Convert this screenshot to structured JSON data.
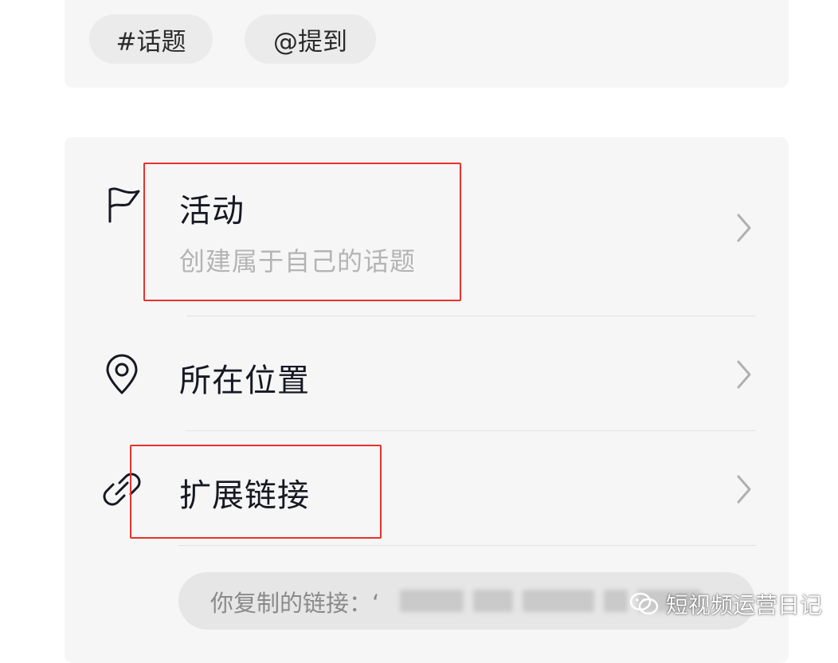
{
  "tags": {
    "topic_label": "#话题",
    "mention_label": "@提到"
  },
  "options": [
    {
      "icon": "flag-icon",
      "title": "活动",
      "subtitle": "创建属于自己的话题"
    },
    {
      "icon": "location-pin-icon",
      "title": "所在位置"
    },
    {
      "icon": "link-icon",
      "title": "扩展链接"
    }
  ],
  "link_input": {
    "label": "你复制的链接：‘"
  },
  "watermark": {
    "text": "短视频运营日记"
  },
  "colors": {
    "highlight": "#e8322d",
    "card_background": "#f6f6f6",
    "subtitle_gray": "#b4b4b4"
  }
}
